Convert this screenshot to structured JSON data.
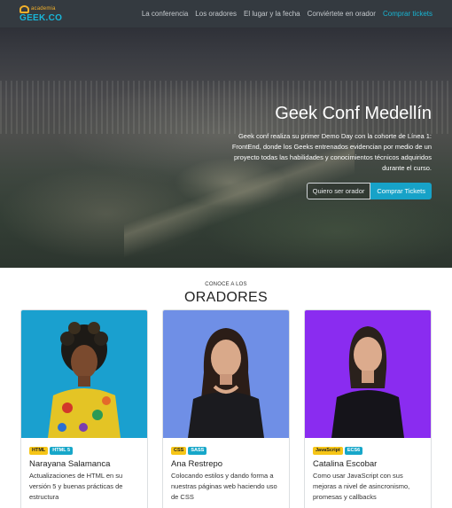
{
  "nav": {
    "brand_small": "academia",
    "brand_main": "GEEK.CO",
    "links": [
      "La conferencia",
      "Los oradores",
      "El lugar y la fecha",
      "Conviértete en orador",
      "Comprar tickets"
    ]
  },
  "hero": {
    "title": "Geek Conf Medellín",
    "text": "Geek conf realiza su primer Demo Day con la cohorte de Línea 1: FrontEnd, donde los Geeks entrenados evidencian por medio de un proyecto todas las habilidades y conocimientos técnicos adquiridos durante el curso.",
    "btn_speaker": "Quiero ser orador",
    "btn_tickets": "Comprar Tickets"
  },
  "speakers": {
    "kicker": "CONOCE A LOS",
    "title": "ORADORES",
    "cards": [
      {
        "badge1": "HTML",
        "badge2": "HTML 5",
        "name": "Narayana Salamanca",
        "desc": "Actualizaciones de HTML en su versión 5 y buenas prácticas de estructura",
        "bg": "#1aa0cf"
      },
      {
        "badge1": "CSS",
        "badge2": "SASS",
        "name": "Ana Restrepo",
        "desc": "Colocando estilos y dando forma a nuestras páginas web haciendo uso de CSS",
        "bg": "#6f8fe6"
      },
      {
        "badge1": "JavaScript",
        "badge2": "ECS6",
        "name": "Catalina Escobar",
        "desc": "Como usar JavaScript con sus mejoras a nivel de asincronismo, promesas y callbacks",
        "bg": "#8a2cf0"
      }
    ]
  },
  "colors": {
    "navbar": "#343a40",
    "accent": "#17a2c8",
    "brand_yellow": "#f2b02a"
  }
}
